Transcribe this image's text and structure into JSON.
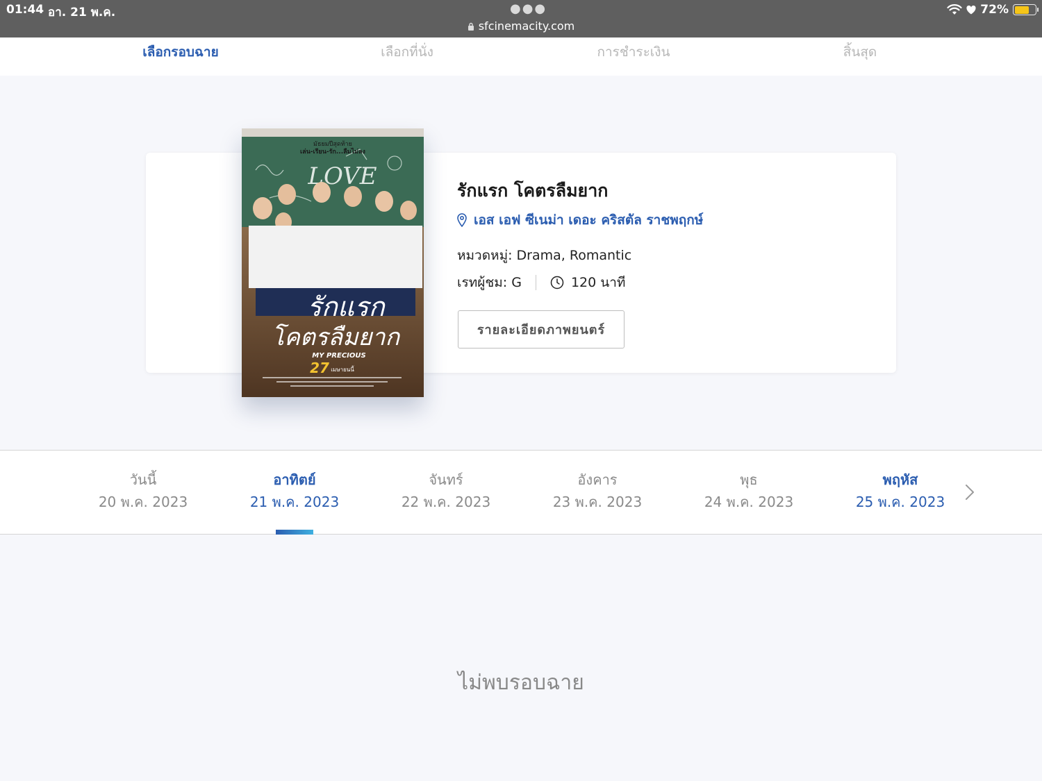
{
  "status_bar": {
    "time": "01:44",
    "date": "อา. 21 พ.ค.",
    "url": "sfcinemacity.com",
    "battery": "72%",
    "battery_level": 0.72
  },
  "steps": [
    {
      "label": "เลือกรอบฉาย",
      "active": true
    },
    {
      "label": "เลือกที่นั่ง",
      "active": false
    },
    {
      "label": "การชำระเงิน",
      "active": false
    },
    {
      "label": "สิ้นสุด",
      "active": false
    }
  ],
  "movie": {
    "title": "รักแรก โคตรลืมยาก",
    "cinema": "เอส เอฟ ซีเนม่า เดอะ คริสตัล ราชพฤกษ์",
    "genre": "หมวดหมู่: Drama, Romantic",
    "rating": "เรทผู้ชม: G",
    "duration": "120 นาที",
    "detail_button": "รายละเอียดภาพยนตร์",
    "poster": {
      "tagline_top": "มัธยมปีสุดท้าย",
      "tagline": "เล่น-เรียน-รัก...ลืมไม่ลง",
      "title_line1": "รักแรก",
      "title_line2": "โคตรลืมยาก",
      "english_title": "MY PRECIOUS",
      "release_day": "27",
      "release_month": "เมษายนนี้"
    }
  },
  "dates": [
    {
      "day": "วันนี้",
      "date": "20 พ.ค. 2023",
      "state": "normal"
    },
    {
      "day": "อาทิตย์",
      "date": "21 พ.ค. 2023",
      "state": "active"
    },
    {
      "day": "จันทร์",
      "date": "22 พ.ค. 2023",
      "state": "normal"
    },
    {
      "day": "อังคาร",
      "date": "23 พ.ค. 2023",
      "state": "normal"
    },
    {
      "day": "พุธ",
      "date": "24 พ.ค. 2023",
      "state": "normal"
    },
    {
      "day": "พฤหัส",
      "date": "25 พ.ค. 2023",
      "state": "highlight"
    }
  ],
  "empty_message": "ไม่พบรอบฉาย",
  "colors": {
    "accent": "#2b5db0",
    "muted": "#8a8a8a",
    "status_bar": "#5f5f5f",
    "battery": "#f5c518"
  }
}
